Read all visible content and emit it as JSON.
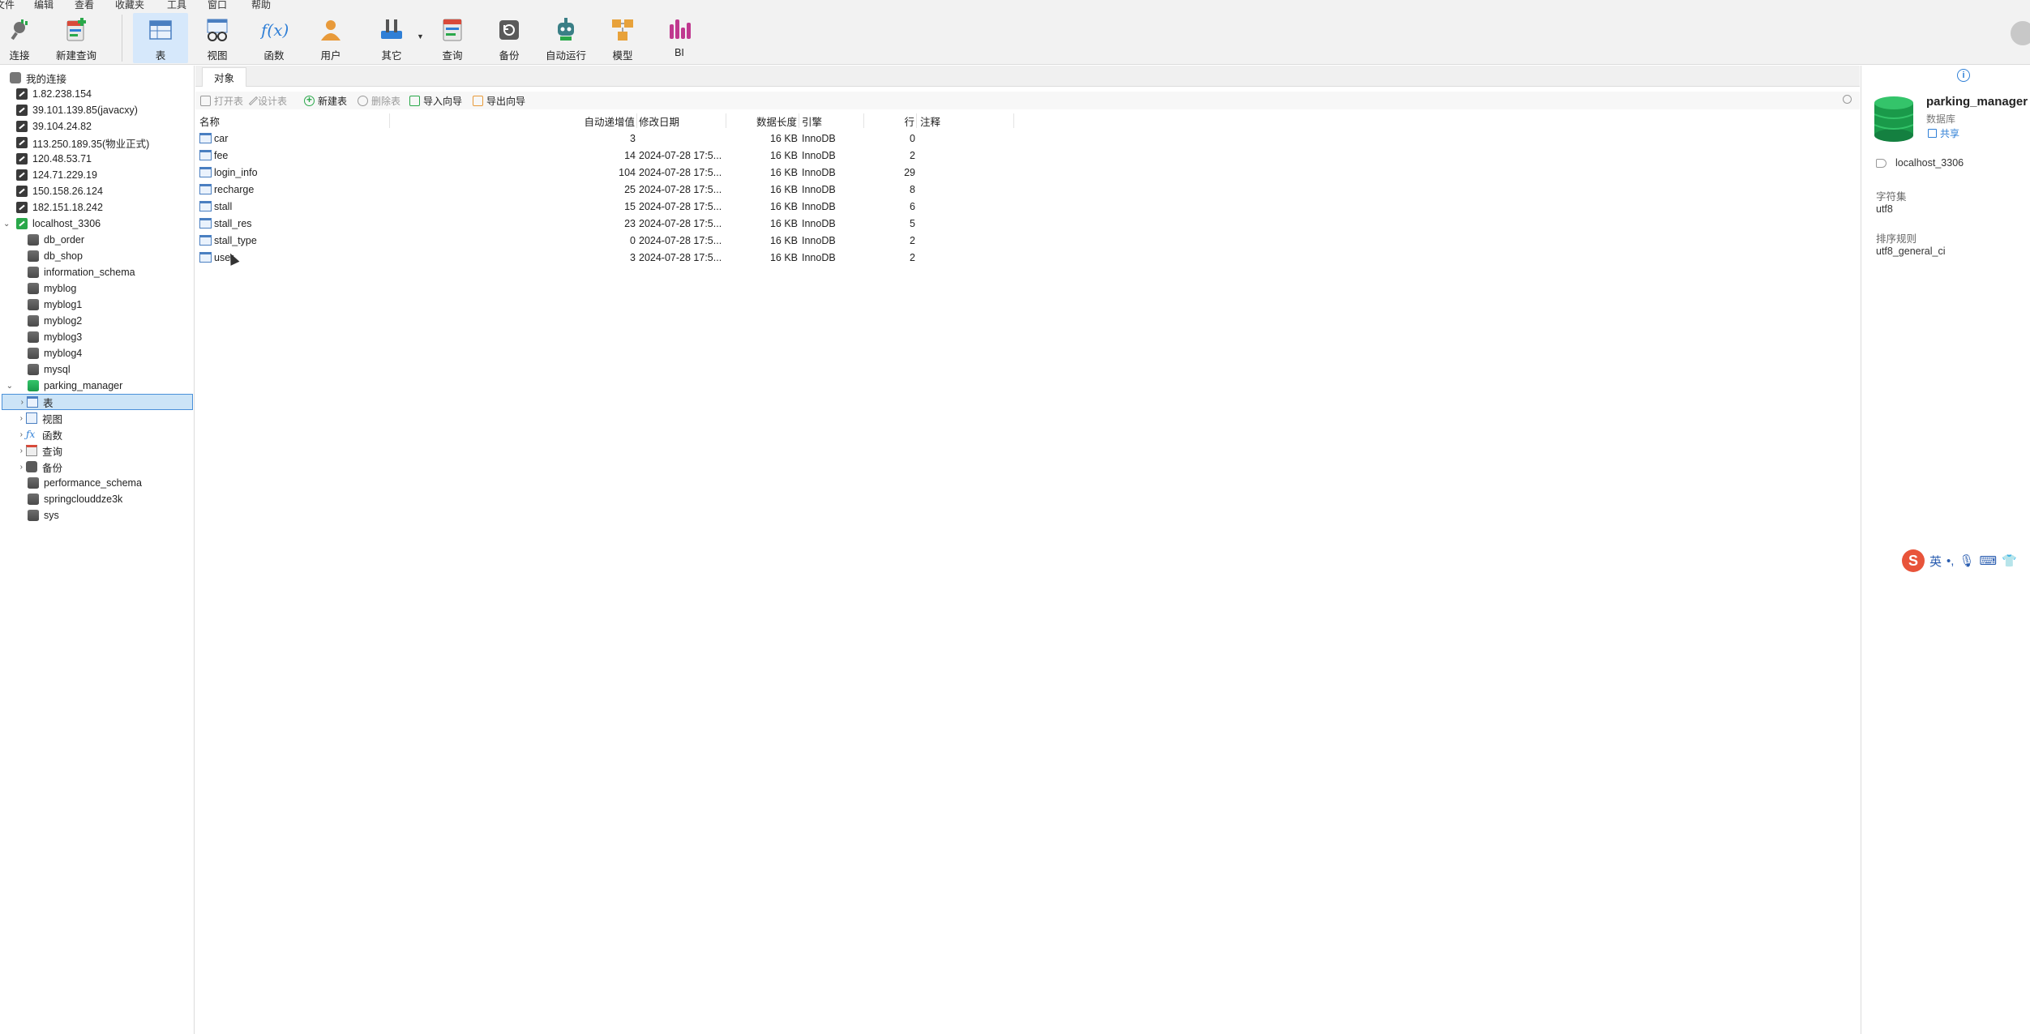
{
  "menu": [
    "文件",
    "编辑",
    "查看",
    "收藏夹",
    "工具",
    "窗口",
    "帮助"
  ],
  "toolbar": {
    "connect": "连接",
    "new_query": "新建查询",
    "table": "表",
    "view": "视图",
    "function": "函数",
    "user": "用户",
    "other": "其它",
    "query": "查询",
    "backup": "备份",
    "autorun": "自动运行",
    "model": "模型",
    "bi": "BI"
  },
  "tree": {
    "root": "我的连接",
    "connections": [
      "1.82.238.154",
      "39.101.139.85(javacxy)",
      "39.104.24.82",
      "113.250.189.35(物业正式)",
      "120.48.53.71",
      "124.71.229.19",
      "150.158.26.124",
      "182.151.18.242",
      "localhost_3306"
    ],
    "databases": [
      "db_order",
      "db_shop",
      "information_schema",
      "myblog",
      "myblog1",
      "myblog2",
      "myblog3",
      "myblog4",
      "mysql",
      "parking_manager"
    ],
    "children": [
      "表",
      "视图",
      "函数",
      "查询",
      "备份"
    ],
    "databases_after": [
      "performance_schema",
      "springclouddze3k",
      "sys"
    ]
  },
  "tab": "对象",
  "object_toolbar": {
    "open_table": "打开表",
    "design_table": "设计表",
    "new_table": "新建表",
    "delete_table": "删除表",
    "import_wizard": "导入向导",
    "export_wizard": "导出向导"
  },
  "grid": {
    "headers": [
      "名称",
      "自动递增值",
      "修改日期",
      "数据长度",
      "引擎",
      "行",
      "注释"
    ],
    "rows": [
      {
        "name": "car",
        "auto_inc": "3",
        "modified": "",
        "size": "16 KB",
        "engine": "InnoDB",
        "rows": "0"
      },
      {
        "name": "fee",
        "auto_inc": "14",
        "modified": "2024-07-28 17:5...",
        "size": "16 KB",
        "engine": "InnoDB",
        "rows": "2"
      },
      {
        "name": "login_info",
        "auto_inc": "104",
        "modified": "2024-07-28 17:5...",
        "size": "16 KB",
        "engine": "InnoDB",
        "rows": "29"
      },
      {
        "name": "recharge",
        "auto_inc": "25",
        "modified": "2024-07-28 17:5...",
        "size": "16 KB",
        "engine": "InnoDB",
        "rows": "8"
      },
      {
        "name": "stall",
        "auto_inc": "15",
        "modified": "2024-07-28 17:5...",
        "size": "16 KB",
        "engine": "InnoDB",
        "rows": "6"
      },
      {
        "name": "stall_res",
        "auto_inc": "23",
        "modified": "2024-07-28 17:5...",
        "size": "16 KB",
        "engine": "InnoDB",
        "rows": "5"
      },
      {
        "name": "stall_type",
        "auto_inc": "0",
        "modified": "2024-07-28 17:5...",
        "size": "16 KB",
        "engine": "InnoDB",
        "rows": "2"
      },
      {
        "name": "user",
        "auto_inc": "3",
        "modified": "2024-07-28 17:5...",
        "size": "16 KB",
        "engine": "InnoDB",
        "rows": "2"
      }
    ]
  },
  "info": {
    "db_name": "parking_manager",
    "db_type": "数据库",
    "share": "共享",
    "connection": "localhost_3306",
    "charset_label": "字符集",
    "charset": "utf8",
    "collation_label": "排序规则",
    "collation": "utf8_general_ci"
  },
  "ime": {
    "lang": "英"
  },
  "colors": {
    "accent": "#2f7fd6",
    "selected_bg": "#cce4f7",
    "green": "#2aa84a"
  }
}
